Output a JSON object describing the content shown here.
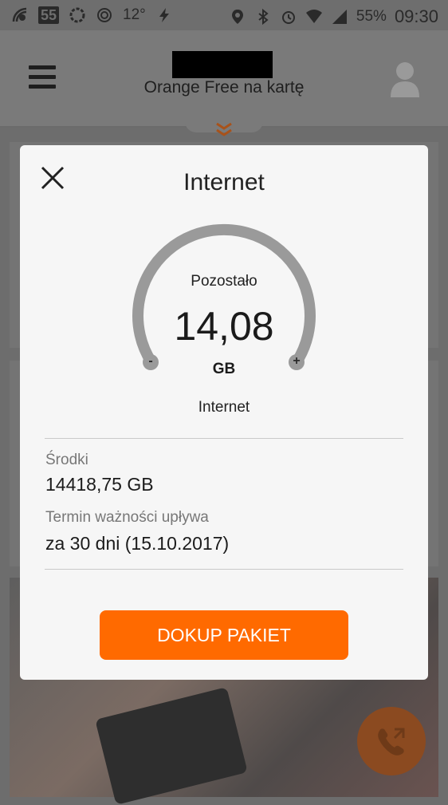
{
  "status_bar": {
    "badge": "55",
    "temperature": "12°",
    "battery": "55%",
    "time": "09:30"
  },
  "header": {
    "title": "Orange Free na kartę"
  },
  "modal": {
    "title": "Internet",
    "gauge": {
      "label": "Pozostało",
      "value": "14,08",
      "unit": "GB",
      "minus": "-",
      "plus": "+"
    },
    "service_label": "Internet",
    "funds": {
      "label": "Środki",
      "value": "14418,75 GB"
    },
    "expiry": {
      "label": "Termin ważności upływa",
      "value": "za 30 dni (15.10.2017)"
    },
    "button": "DOKUP PAKIET"
  },
  "colors": {
    "accent": "#ff6a00",
    "gauge": "#9a9a9a"
  }
}
